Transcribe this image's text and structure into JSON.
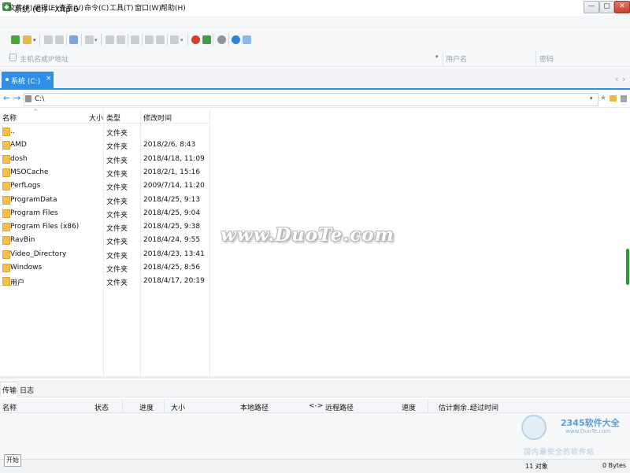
{
  "window": {
    "title": "系统 (C:) - Xftp 6",
    "controls": [
      "—",
      "▢",
      "✕"
    ]
  },
  "menu": [
    "文件(F)",
    "编辑(E)",
    "查看(V)",
    "命令(C)",
    "工具(T)",
    "窗口(W)",
    "帮助(H)"
  ],
  "address": {
    "host_placeholder": "主机名或IP地址",
    "user_placeholder": "用户名",
    "password_placeholder": "密码"
  },
  "tabs": [
    {
      "label": "系统 (C:)",
      "close": "×"
    }
  ],
  "tab_nav": [
    "‹",
    "›"
  ],
  "path": {
    "value": "C:\\"
  },
  "file_table": {
    "columns": [
      "名称",
      "大小",
      "类型",
      "修改时间"
    ],
    "rows": [
      {
        "name": "..",
        "size": "",
        "type": "文件夹",
        "modified": ""
      },
      {
        "name": "AMD",
        "size": "",
        "type": "文件夹",
        "modified": "2018/2/6, 8:43"
      },
      {
        "name": "dosh",
        "size": "",
        "type": "文件夹",
        "modified": "2018/4/18, 11:09"
      },
      {
        "name": "MSOCache",
        "size": "",
        "type": "文件夹",
        "modified": "2018/2/1, 15:16"
      },
      {
        "name": "PerfLogs",
        "size": "",
        "type": "文件夹",
        "modified": "2009/7/14, 11:20"
      },
      {
        "name": "ProgramData",
        "size": "",
        "type": "文件夹",
        "modified": "2018/4/25, 9:13"
      },
      {
        "name": "Program Files",
        "size": "",
        "type": "文件夹",
        "modified": "2018/4/25, 9:04"
      },
      {
        "name": "Program Files (x86)",
        "size": "",
        "type": "文件夹",
        "modified": "2018/4/25, 9:38"
      },
      {
        "name": "RavBin",
        "size": "",
        "type": "文件夹",
        "modified": "2018/4/24, 9:55"
      },
      {
        "name": "Video_Directory",
        "size": "",
        "type": "文件夹",
        "modified": "2018/4/23, 13:41"
      },
      {
        "name": "Windows",
        "size": "",
        "type": "文件夹",
        "modified": "2018/4/25, 8:56"
      },
      {
        "name": "用户",
        "size": "",
        "type": "文件夹",
        "modified": "2018/4/17, 20:19"
      }
    ]
  },
  "watermark": "www.DuoTe.com",
  "lower_tabs": [
    "传输",
    "日志"
  ],
  "transfer_columns": [
    "名称",
    "状态",
    "进度",
    "大小",
    "本地路径",
    "<->",
    "远程路径",
    "速度",
    "估计剩余...",
    "经过时间"
  ],
  "start_button": "开始",
  "status": {
    "objects": "11 对象",
    "bytes": "0 Bytes"
  },
  "logo": {
    "text": "2345软件大全",
    "url": "www.DuoTe.com",
    "tagline": "国内最安全的软件站"
  },
  "colors": {
    "accent": "#2f8fe6",
    "folder": "#f2c14e",
    "scroll_green": "#2d9a35"
  }
}
